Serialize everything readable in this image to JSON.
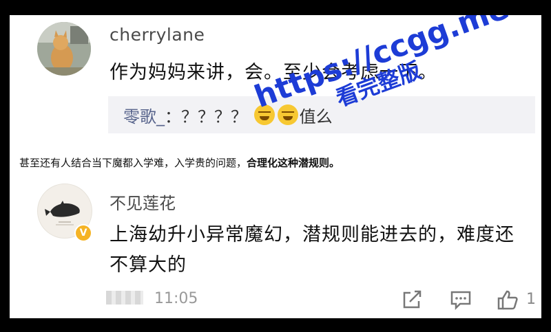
{
  "comment1": {
    "username": "cherrylane",
    "text": "作为妈妈来讲，会。至少会考虑一下。",
    "reply": {
      "user": "零歌_",
      "text": "：？？？？",
      "suffix": "值么"
    }
  },
  "caption": {
    "normal": "甚至还有人结合当下魔都入学难，入学贵的问题，",
    "bold": "合理化这种潜规则。"
  },
  "watermark": {
    "url": "https://ccgg.me",
    "sub": "看完整版"
  },
  "comment2": {
    "username": "不见莲花",
    "text": "上海幼升小异常魔幻，潜规则能进去的，难度还不算大的",
    "time": "11:05",
    "like_count": "1"
  },
  "icons": {
    "share": "share-icon",
    "reply": "comment-icon",
    "like": "thumbs-up-icon",
    "verified": "verified-badge-icon"
  },
  "colors": {
    "reply_user": "#58648c",
    "watermark": "#1d3cd6",
    "badge": "#f5b324"
  }
}
